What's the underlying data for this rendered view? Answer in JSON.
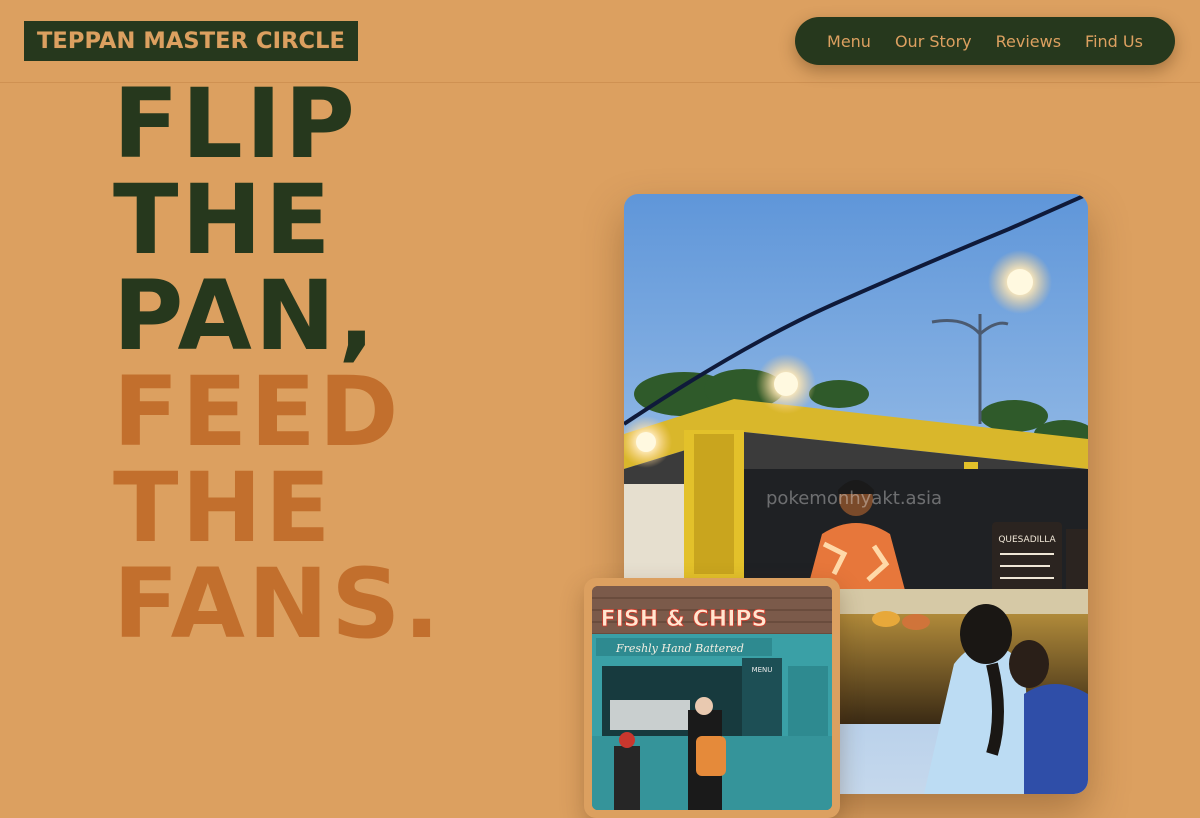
{
  "brand": {
    "name": "TEPPAN MASTER CIRCLE"
  },
  "nav": {
    "items": [
      {
        "label": "Menu"
      },
      {
        "label": "Our Story"
      },
      {
        "label": "Reviews"
      },
      {
        "label": "Find Us"
      }
    ]
  },
  "hero": {
    "lines_dark": [
      "FLIP",
      "THE",
      "PAN,"
    ],
    "lines_orange": [
      "FEED",
      "THE",
      "FANS."
    ]
  },
  "photos": {
    "main_watermark": "pokemonhyakt.asia",
    "small_sign": "FISH & CHIPS",
    "small_subsign": "Freshly Hand Battered",
    "small_menu": "MENU",
    "stall_board": "QUESADILLA"
  },
  "colors": {
    "background": "#dca060",
    "dark_green": "#26381d",
    "orange": "#c26f2d"
  }
}
